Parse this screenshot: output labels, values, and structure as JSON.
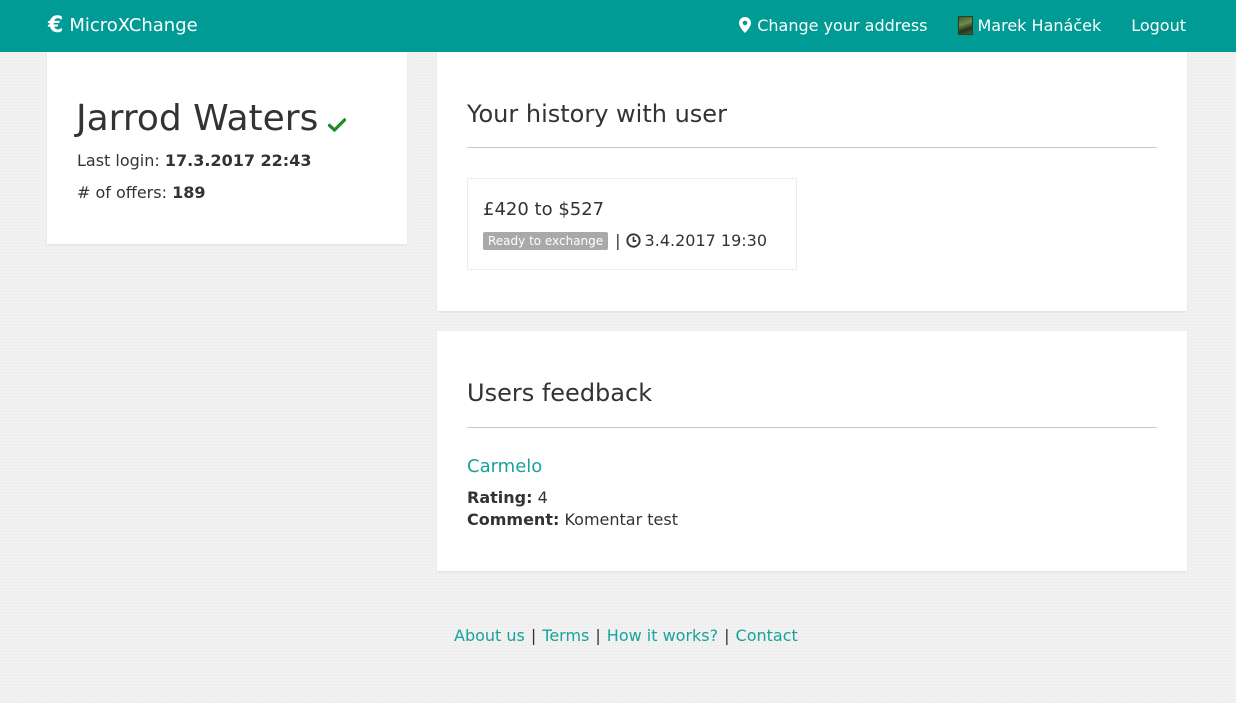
{
  "navbar": {
    "brand": "MicroXChange",
    "brand_icon": "euro-icon",
    "change_address": "Change your address",
    "user_name": "Marek Hanáček",
    "logout": "Logout",
    "color": "#009b95"
  },
  "profile": {
    "name": "Jarrod Waters",
    "verified_icon": "check-icon",
    "last_login_label": "Last login:",
    "last_login_value": "17.3.2017 22:43",
    "offers_label": "# of offers:",
    "offers_value": "189"
  },
  "history": {
    "title": "Your history with user",
    "offers": [
      {
        "title": "£420 to $527",
        "status": "Ready to exchange",
        "separator": "|",
        "datetime": "3.4.2017 19:30"
      }
    ]
  },
  "feedback": {
    "title": "Users feedback",
    "items": [
      {
        "user": "Carmelo",
        "rating_label": "Rating:",
        "rating_value": "4",
        "comment_label": "Comment:",
        "comment_value": "Komentar test"
      }
    ]
  },
  "footer": {
    "links": [
      "About us",
      "Terms",
      "How it works?",
      "Contact"
    ],
    "separator": "|",
    "link_color": "#17a39c"
  }
}
